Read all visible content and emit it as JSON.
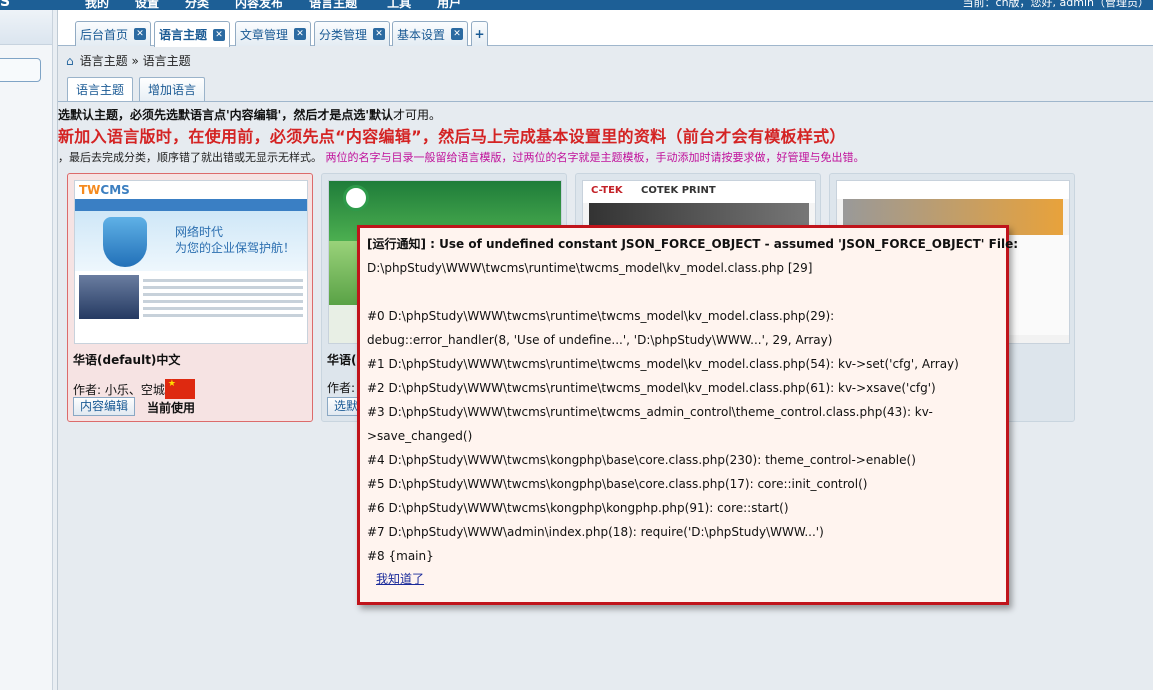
{
  "topbar": {
    "logo": "S",
    "nav": [
      "我的",
      "设置",
      "分类",
      "内容发布",
      "语言主题",
      "工具",
      "用户"
    ],
    "active_index": 4,
    "userinfo": "当前：cn版，您好, admin（管理员）"
  },
  "tabs": [
    {
      "label": "后台首页",
      "active": false
    },
    {
      "label": "语言主题",
      "active": true
    },
    {
      "label": "文章管理",
      "active": false
    },
    {
      "label": "分类管理",
      "active": false
    },
    {
      "label": "基本设置",
      "active": false
    }
  ],
  "tab_close_glyph": "✕",
  "tab_add_glyph": "+",
  "breadcrumb": "语言主题 » 语言主题",
  "subtabs": [
    "语言主题",
    "增加语言"
  ],
  "notice1_bold": "选默认主题，必须先选默语言点'内容编辑'，然后才是点选'默认",
  "notice1_tail": "才可用。",
  "notice2": "新加入语言版时，在使用前，必须先点“内容编辑”，然后马上完成基本设置里的资料（前台才会有模板样式）",
  "notice3_black": "，最后去完成分类，顺序错了就出错或无显示无样式。",
  "notice3_magenta": "两位的名字与目录一般留给语言模版，过两位的名字就是主题模板，手动添加时请按要求做，好管理与免出错。",
  "cards": [
    {
      "name": "华语(default)中文",
      "author": "作者: 小乐、空城",
      "edit_label": "内容编辑",
      "status": "当前使用",
      "thumb": {
        "logo_a": "TW",
        "logo_b": "CMS",
        "text1": "网络时代",
        "text2": "为您的企业保驾护航！"
      }
    },
    {
      "name": "华语(",
      "author": "作者:",
      "edit_label": "选默"
    },
    {
      "thumb": {
        "logo": "C-TEK",
        "title": "COTEK PRINT"
      }
    },
    {}
  ],
  "error": {
    "lines": [
      "[运行通知] : Use of undefined constant JSON_FORCE_OBJECT - assumed 'JSON_FORCE_OBJECT' File:",
      "D:\\phpStudy\\WWW\\twcms\\runtime\\twcms_model\\kv_model.class.php [29]",
      "",
      "#0 D:\\phpStudy\\WWW\\twcms\\runtime\\twcms_model\\kv_model.class.php(29):",
      "debug::error_handler(8, 'Use of undefine...', 'D:\\phpStudy\\WWW...', 29, Array)",
      "#1 D:\\phpStudy\\WWW\\twcms\\runtime\\twcms_model\\kv_model.class.php(54): kv->set('cfg', Array)",
      "#2 D:\\phpStudy\\WWW\\twcms\\runtime\\twcms_model\\kv_model.class.php(61): kv->xsave('cfg')",
      "#3 D:\\phpStudy\\WWW\\twcms\\runtime\\twcms_admin_control\\theme_control.class.php(43): kv-",
      ">save_changed()",
      "#4 D:\\phpStudy\\WWW\\twcms\\kongphp\\base\\core.class.php(230): theme_control->enable()",
      "#5 D:\\phpStudy\\WWW\\twcms\\kongphp\\base\\core.class.php(17): core::init_control()",
      "#6 D:\\phpStudy\\WWW\\twcms\\kongphp\\kongphp.php(91): core::start()",
      "#7 D:\\phpStudy\\WWW\\admin\\index.php(18): require('D:\\phpStudy\\WWW...')",
      "#8 {main}"
    ],
    "ok_label": "我知道了"
  },
  "colors": {
    "accent": "#1d5f96",
    "notice_red": "#d42323",
    "notice_magenta": "#c0109a",
    "error_border": "#c0141b"
  }
}
